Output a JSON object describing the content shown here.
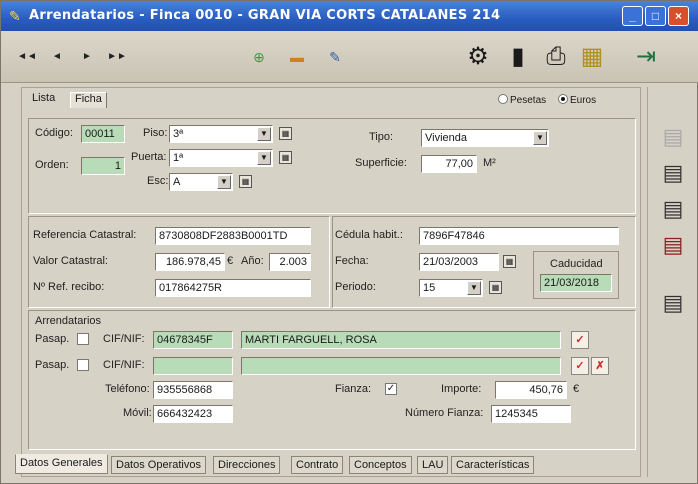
{
  "window": {
    "title": "Arrendatarios - Finca 0010 - GRAN VIA CORTS CATALANES 214",
    "minimize": "_",
    "maximize": "□",
    "close": "×"
  },
  "toolbar": {
    "nav": [
      "◄◄",
      "◄",
      "►",
      "►►"
    ],
    "icons": [
      "add-icon",
      "remove-icon",
      "edit-icon",
      "tools-icon",
      "folder-icon",
      "printer-icon",
      "grid-icon",
      "exit-icon"
    ]
  },
  "view_tabs": {
    "lista": "Lista",
    "ficha": "Ficha"
  },
  "currency": {
    "pesetas": "Pesetas",
    "euros": "Euros",
    "selected": "Euros"
  },
  "general": {
    "codigo_label": "Código:",
    "codigo": "00011",
    "orden_label": "Orden:",
    "orden": "1",
    "piso_label": "Piso:",
    "piso": "3ª",
    "puerta_label": "Puerta:",
    "puerta": "1ª",
    "esc_label": "Esc:",
    "esc": "A",
    "tipo_label": "Tipo:",
    "tipo": "Vivienda",
    "superficie_label": "Superficie:",
    "superficie": "77,00",
    "superficie_unit": "M²"
  },
  "catastro": {
    "ref_label": "Referencia Catastral:",
    "ref": "8730808DF2883B0001TD",
    "valor_label": "Valor Catastral:",
    "valor": "186.978,45",
    "valor_unit": "€",
    "anio_label": "Año:",
    "anio": "2.003",
    "recibo_label": "Nº Ref. recibo:",
    "recibo": "017864275R"
  },
  "cedula": {
    "cedula_label": "Cédula habit.:",
    "cedula": "7896F47846",
    "fecha_label": "Fecha:",
    "fecha": "21/03/2003",
    "periodo_label": "Periodo:",
    "periodo": "15",
    "caducidad_label": "Caducidad",
    "caducidad": "21/03/2018"
  },
  "arrendatarios": {
    "section_label": "Arrendatarios",
    "rows": [
      {
        "pasap_label": "Pasap.",
        "cif_label": "CIF/NIF:",
        "cif": "04678345F",
        "name": "MARTI FARGUELL, ROSA"
      },
      {
        "pasap_label": "Pasap.",
        "cif_label": "CIF/NIF:",
        "cif": "",
        "name": ""
      }
    ],
    "telefono_label": "Teléfono:",
    "telefono": "935556868",
    "movil_label": "Móvil:",
    "movil": "666432423",
    "fianza_label": "Fianza:",
    "fianza_checked": "✓",
    "importe_label": "Importe:",
    "importe": "450,76",
    "importe_unit": "€",
    "num_fianza_label": "Número Fianza:",
    "num_fianza": "1245345"
  },
  "bottom_tabs": [
    "Datos Generales",
    "Datos Operativos",
    "Direcciones",
    "Contrato",
    "Conceptos",
    "LAU",
    "Características"
  ],
  "sidebar_icons": [
    "document-icon",
    "receipt-icon",
    "receipt-stack-icon",
    "receipt-alert-icon",
    "scroll-icon"
  ]
}
